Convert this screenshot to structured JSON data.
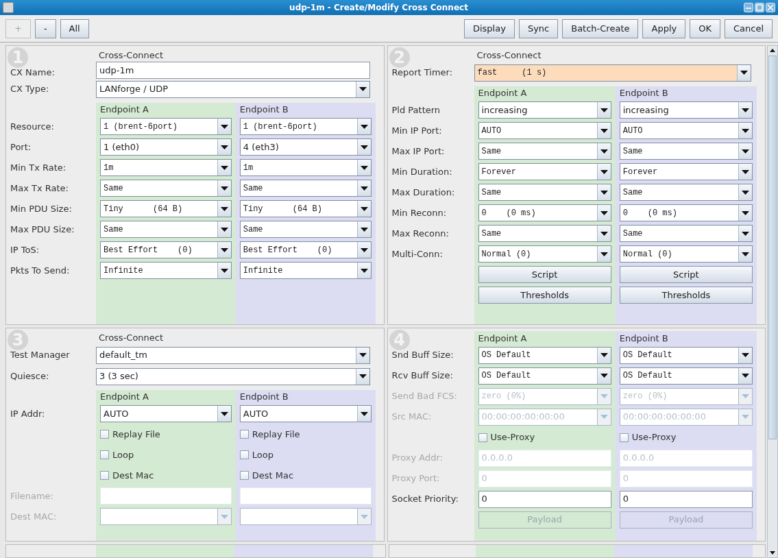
{
  "window": {
    "title": "udp-1m - Create/Modify Cross Connect"
  },
  "toolbar": {
    "left": [
      {
        "label": "+",
        "disabled": true
      },
      {
        "label": "-",
        "disabled": false
      },
      {
        "label": "All",
        "disabled": false
      }
    ],
    "right": [
      {
        "label": "Display",
        "disabled": false
      },
      {
        "label": "Sync",
        "disabled": false
      },
      {
        "label": "Batch-Create",
        "disabled": false
      },
      {
        "label": "Apply",
        "disabled": false
      },
      {
        "label": "OK",
        "disabled": false
      },
      {
        "label": "Cancel",
        "disabled": false
      }
    ]
  },
  "panels": [
    {
      "number": "1",
      "cx_label": "Cross-Connect",
      "cx_rows": [
        {
          "label": "CX Name:",
          "kind": "text",
          "value": "udp-1m",
          "highlighted": false
        },
        {
          "label": "CX Type:",
          "kind": "combo",
          "value": "LANforge / UDP",
          "highlighted": false
        }
      ],
      "endpoint_headers": [
        "Endpoint A",
        "Endpoint B"
      ],
      "rows": [
        {
          "label": "Resource:",
          "kind": "combo",
          "disabled": false,
          "cells": [
            {
              "value": "1 (brent-6port)",
              "mono": true
            },
            {
              "value": "1 (brent-6port)",
              "mono": true
            }
          ]
        },
        {
          "label": "Port:",
          "kind": "combo",
          "disabled": false,
          "cells": [
            {
              "value": "1 (eth0)",
              "mono": false
            },
            {
              "value": "4 (eth3)",
              "mono": false
            }
          ]
        },
        {
          "label": "Min Tx Rate:",
          "kind": "combo",
          "disabled": false,
          "cells": [
            {
              "value": "1m",
              "mono": true
            },
            {
              "value": "1m",
              "mono": true
            }
          ]
        },
        {
          "label": "Max Tx Rate:",
          "kind": "combo",
          "disabled": false,
          "cells": [
            {
              "value": "Same",
              "mono": true
            },
            {
              "value": "Same",
              "mono": true
            }
          ]
        },
        {
          "label": "Min PDU Size:",
          "kind": "combo",
          "disabled": false,
          "cells": [
            {
              "value": "Tiny      (64 B)",
              "mono": true
            },
            {
              "value": "Tiny      (64 B)",
              "mono": true
            }
          ]
        },
        {
          "label": "Max PDU Size:",
          "kind": "combo",
          "disabled": false,
          "cells": [
            {
              "value": "Same",
              "mono": true
            },
            {
              "value": "Same",
              "mono": true
            }
          ]
        },
        {
          "label": "IP ToS:",
          "kind": "combo",
          "disabled": false,
          "cells": [
            {
              "value": "Best Effort    (0)",
              "mono": true
            },
            {
              "value": "Best Effort    (0)",
              "mono": true
            }
          ]
        },
        {
          "label": "Pkts To Send:",
          "kind": "combo",
          "disabled": false,
          "cells": [
            {
              "value": "Infinite",
              "mono": true
            },
            {
              "value": "Infinite",
              "mono": true
            }
          ]
        }
      ]
    },
    {
      "number": "2",
      "cx_label": "Cross-Connect",
      "cx_rows": [
        {
          "label": "Report Timer:",
          "kind": "combo",
          "value": "fast     (1 s)",
          "highlighted": true
        }
      ],
      "endpoint_headers": [
        "Endpoint A",
        "Endpoint B"
      ],
      "rows": [
        {
          "label": "Pld Pattern",
          "kind": "combo",
          "disabled": false,
          "cells": [
            {
              "value": "increasing",
              "mono": false
            },
            {
              "value": "increasing",
              "mono": false
            }
          ]
        },
        {
          "label": "Min IP Port:",
          "kind": "combo",
          "disabled": false,
          "cells": [
            {
              "value": "AUTO",
              "mono": true
            },
            {
              "value": "AUTO",
              "mono": true
            }
          ]
        },
        {
          "label": "Max IP Port:",
          "kind": "combo",
          "disabled": false,
          "cells": [
            {
              "value": "Same",
              "mono": true
            },
            {
              "value": "Same",
              "mono": true
            }
          ]
        },
        {
          "label": "Min Duration:",
          "kind": "combo",
          "disabled": false,
          "cells": [
            {
              "value": "Forever",
              "mono": true
            },
            {
              "value": "Forever",
              "mono": true
            }
          ]
        },
        {
          "label": "Max Duration:",
          "kind": "combo",
          "disabled": false,
          "cells": [
            {
              "value": "Same",
              "mono": true
            },
            {
              "value": "Same",
              "mono": true
            }
          ]
        },
        {
          "label": "Min Reconn:",
          "kind": "combo",
          "disabled": false,
          "cells": [
            {
              "value": "0    (0 ms)",
              "mono": true
            },
            {
              "value": "0    (0 ms)",
              "mono": true
            }
          ]
        },
        {
          "label": "Max Reconn:",
          "kind": "combo",
          "disabled": false,
          "cells": [
            {
              "value": "Same",
              "mono": true
            },
            {
              "value": "Same",
              "mono": true
            }
          ]
        },
        {
          "label": "Multi-Conn:",
          "kind": "combo",
          "disabled": false,
          "cells": [
            {
              "value": "Normal (0)",
              "mono": true
            },
            {
              "value": "Normal (0)",
              "mono": true
            }
          ]
        },
        {
          "kind": "button",
          "disabled": false,
          "cells": [
            {
              "value": "Script"
            },
            {
              "value": "Script"
            }
          ]
        },
        {
          "kind": "button",
          "disabled": false,
          "cells": [
            {
              "value": "Thresholds"
            },
            {
              "value": "Thresholds"
            }
          ]
        }
      ]
    },
    {
      "number": "3",
      "cx_label": "Cross-Connect",
      "cx_rows": [
        {
          "label": "Test Manager",
          "kind": "combo",
          "value": "default_tm",
          "highlighted": false
        },
        {
          "label": "Quiesce:",
          "kind": "combo",
          "value": "3 (3 sec)",
          "highlighted": false
        }
      ],
      "endpoint_headers": [
        "Endpoint A",
        "Endpoint B"
      ],
      "rows": [
        {
          "label": "IP Addr:",
          "kind": "combo",
          "disabled": false,
          "cells": [
            {
              "value": "AUTO",
              "mono": false
            },
            {
              "value": "AUTO",
              "mono": false
            }
          ]
        },
        {
          "kind": "check",
          "disabled": false,
          "cells": [
            {
              "value": "Replay File",
              "checked": false
            },
            {
              "value": "Replay File",
              "checked": false
            }
          ]
        },
        {
          "kind": "check",
          "disabled": false,
          "cells": [
            {
              "value": "Loop",
              "checked": false
            },
            {
              "value": "Loop",
              "checked": false
            }
          ]
        },
        {
          "kind": "check",
          "disabled": false,
          "cells": [
            {
              "value": "Dest Mac",
              "checked": false
            },
            {
              "value": "Dest Mac",
              "checked": false
            }
          ]
        },
        {
          "label": "Filename:",
          "kind": "text",
          "disabled": true,
          "cells": [
            {},
            {}
          ]
        },
        {
          "label": "Dest MAC:",
          "kind": "combo",
          "disabled": true,
          "cells": [
            {},
            {}
          ]
        }
      ]
    },
    {
      "number": "4",
      "endpoint_headers": [
        "Endpoint A",
        "Endpoint B"
      ],
      "rows": [
        {
          "label": "Snd Buff Size:",
          "kind": "combo",
          "disabled": false,
          "cells": [
            {
              "value": "OS Default",
              "mono": true
            },
            {
              "value": "OS Default",
              "mono": true
            }
          ]
        },
        {
          "label": "Rcv Buff Size:",
          "kind": "combo",
          "disabled": false,
          "cells": [
            {
              "value": "OS Default",
              "mono": true
            },
            {
              "value": "OS Default",
              "mono": true
            }
          ]
        },
        {
          "label": "Send Bad FCS:",
          "kind": "combo",
          "disabled": true,
          "cells": [
            {
              "value": "zero (0%)",
              "mono": true
            },
            {
              "value": "zero (0%)",
              "mono": true
            }
          ]
        },
        {
          "label": "Src MAC:",
          "kind": "combo",
          "disabled": true,
          "cells": [
            {
              "value": "00:00:00:00:00:00",
              "mono": false
            },
            {
              "value": "00:00:00:00:00:00",
              "mono": false
            }
          ]
        },
        {
          "kind": "check",
          "disabled": false,
          "cells": [
            {
              "value": "Use-Proxy",
              "checked": false
            },
            {
              "value": "Use-Proxy",
              "checked": false
            }
          ]
        },
        {
          "label": "Proxy Addr:",
          "kind": "text",
          "disabled": true,
          "cells": [
            {
              "value": "0.0.0.0",
              "mono": false
            },
            {
              "value": "0.0.0.0",
              "mono": false
            }
          ]
        },
        {
          "label": "Proxy Port:",
          "kind": "text",
          "disabled": true,
          "cells": [
            {
              "value": "0",
              "mono": false
            },
            {
              "value": "0",
              "mono": false
            }
          ]
        },
        {
          "label": "Socket Priority:",
          "kind": "text",
          "disabled": false,
          "cells": [
            {
              "value": "0",
              "mono": false
            },
            {
              "value": "0",
              "mono": false
            }
          ]
        },
        {
          "kind": "button",
          "disabled": true,
          "cells": [
            {
              "value": "Payload"
            },
            {
              "value": "Payload"
            }
          ]
        }
      ]
    }
  ]
}
